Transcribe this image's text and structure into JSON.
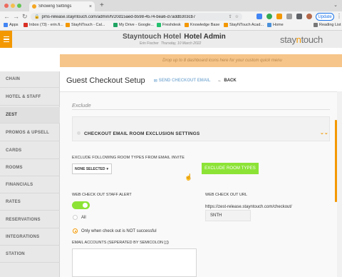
{
  "browser": {
    "tab_title": "Showing Settings",
    "tab_close": "×",
    "new_tab": "+",
    "url": "pms-release.stayntouch.com/admin/h/20d15aed-b598-4574-bea6-d7addb303cb7",
    "update_label": "Update",
    "bookmarks": [
      {
        "label": "Apps",
        "color": "#4285f4"
      },
      {
        "label": "Inbox (73) - erin.fi...",
        "color": "#d93025"
      },
      {
        "label": "StayNTouch - Cal...",
        "color": "#f39800"
      },
      {
        "label": "My Drive - Google...",
        "color": "#1fa463"
      },
      {
        "label": "Freshdesk",
        "color": "#25c16f"
      },
      {
        "label": "Knowledge Base",
        "color": "#f39800"
      },
      {
        "label": "StayNTouch Acad...",
        "color": "#f39800"
      },
      {
        "label": "Home",
        "color": "#4a90d9"
      }
    ],
    "reading_list": "Reading List"
  },
  "header": {
    "hotel_name": "Stayntouch Hotel",
    "section": "Hotel Admin",
    "user": "Erin Fischer",
    "date": "Thursday, 10 March 2022",
    "logo_pre": "stay",
    "logo_n": "n",
    "logo_post": "touch",
    "quick_menu_hint": "Drop up to 8 dashboard icons here for your custom quick menu"
  },
  "sidebar": {
    "items": [
      "CHAIN",
      "HOTEL & STAFF",
      "ZEST",
      "PROMOS & UPSELL",
      "CARDS",
      "ROOMS",
      "FINANCIALS",
      "RATES",
      "RESERVATIONS",
      "INTEGRATIONS",
      "STATION"
    ],
    "active": "ZEST"
  },
  "page": {
    "title": "Guest Checkout Setup",
    "send_email": "SEND CHECKOUT EMAIL",
    "back": "BACK",
    "exclude_heading": "Exclude",
    "section_title": "CHECKOUT EMAIL ROOM EXCLUSION SETTINGS",
    "exclude_label": "EXCLUDE FOLLOWING ROOM TYPES FROM EMAIL INVITE",
    "select_value": "NONE SELECTED",
    "exclude_button": "EXCLUDE ROOM TYPES",
    "staff_alert_label": "WEB CHECK OUT STAFF ALERT",
    "staff_alert_enabled": true,
    "radio_all": "All",
    "radio_unsuccessful": "Only when check out is NOT successful",
    "url_label": "WEB CHECK OUT URL",
    "url_value": "https://zest-release.stayntouch.com/checkout/",
    "url_suffix": "SNTH",
    "email_label": "EMAIL ACCOUNTS (SEPERATED BY SEMICOLON [;])",
    "email_value": ""
  },
  "colors": {
    "accent": "#f39800",
    "success": "#8ce336",
    "link": "#8cb6d9"
  }
}
